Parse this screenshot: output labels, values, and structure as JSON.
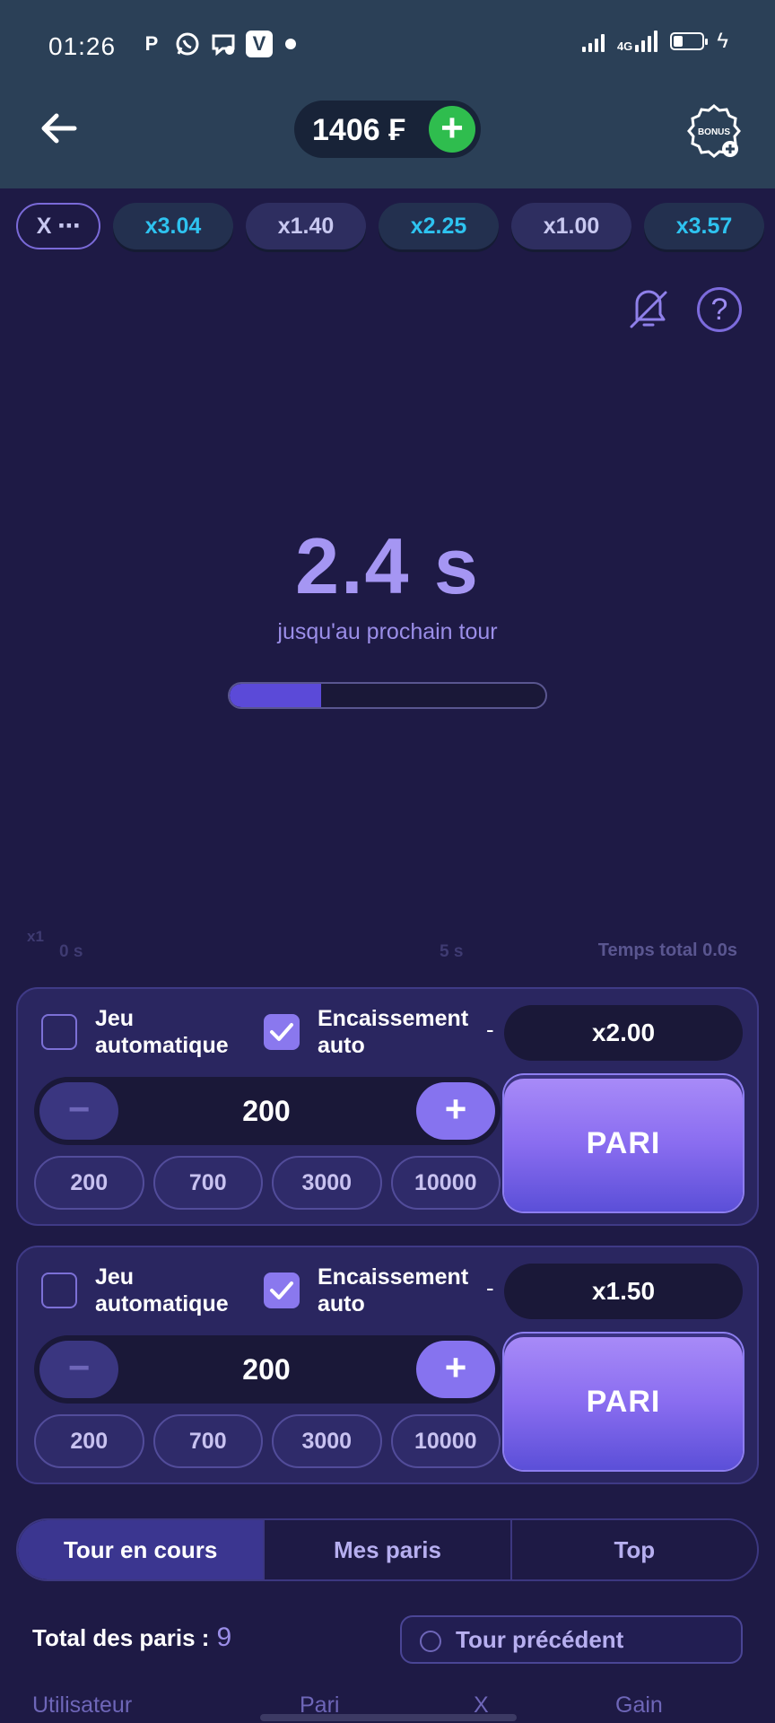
{
  "status_bar": {
    "time": "01:26",
    "app_icons": [
      "P",
      "whatsapp-icon",
      "messenger-icon",
      "V",
      "dot"
    ],
    "network_label": "4G"
  },
  "header": {
    "balance": "1406 ₣",
    "add_label": "+",
    "bonus_label": "BONUS"
  },
  "history": {
    "more_label": "X ⋯",
    "items": [
      "x3.04",
      "x1.40",
      "x2.25",
      "x1.00",
      "x3.57"
    ]
  },
  "game": {
    "countdown": "2.4 s",
    "subtitle": "jusqu'au prochain tour",
    "progress_fraction": 0.29,
    "axis_multiplier": "x1",
    "axis_start": "0 s",
    "axis_mid": "5 s",
    "total_time": "Temps total 0.0s",
    "help_label": "?"
  },
  "bets": [
    {
      "auto_play_label": "Jeu automatique",
      "auto_cashout_label": "Encaissement auto",
      "auto_play_checked": false,
      "auto_cashout_checked": true,
      "dash": "-",
      "multiplier": "x2.00",
      "amount": "200",
      "minus": "−",
      "plus": "+",
      "quick": [
        "200",
        "700",
        "3000",
        "10000"
      ],
      "bet_label": "PARI"
    },
    {
      "auto_play_label": "Jeu automatique",
      "auto_cashout_label": "Encaissement auto",
      "auto_play_checked": false,
      "auto_cashout_checked": true,
      "dash": "-",
      "multiplier": "x1.50",
      "amount": "200",
      "minus": "−",
      "plus": "+",
      "quick": [
        "200",
        "700",
        "3000",
        "10000"
      ],
      "bet_label": "PARI"
    }
  ],
  "tabs": [
    "Tour en cours",
    "Mes paris",
    "Top"
  ],
  "summary": {
    "total_label": "Total des paris :",
    "total_value": "9",
    "previous_round": "Tour précédent"
  },
  "table_headers": [
    "Utilisateur",
    "Pari",
    "X",
    "Gain"
  ],
  "colors": {
    "background": "#1e1a45",
    "header": "#2b4057",
    "accent": "#8673ef",
    "add_green": "#2fbd4e",
    "chip_blue": "#2ec3f0"
  }
}
